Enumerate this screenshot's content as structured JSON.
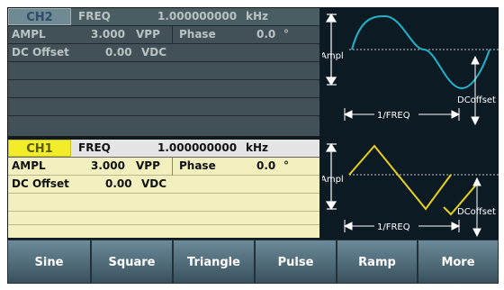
{
  "ch2": {
    "badge": "CH2",
    "freq_label": "FREQ",
    "freq_value": "1.000000000",
    "freq_unit": "kHz",
    "ampl_label": "AMPL",
    "ampl_value": "3.000",
    "ampl_unit": "VPP",
    "phase_label": "Phase",
    "phase_value": "0.0",
    "phase_unit": "°",
    "dc_label": "DC Offset",
    "dc_value": "0.00",
    "dc_unit": "VDC",
    "preview": {
      "ampl": "Ampl",
      "offset": "DCoffset",
      "period": "1/FREQ"
    },
    "colors": {
      "wave": "#1fb3c9",
      "panel": "#415157"
    }
  },
  "ch1": {
    "badge": "CH1",
    "freq_label": "FREQ",
    "freq_value": "1.000000000",
    "freq_unit": "kHz",
    "ampl_label": "AMPL",
    "ampl_value": "3.000",
    "ampl_unit": "VPP",
    "phase_label": "Phase",
    "phase_value": "0.0",
    "phase_unit": "°",
    "dc_label": "DC Offset",
    "dc_value": "0.00",
    "dc_unit": "VDC",
    "preview": {
      "ampl": "Ampl",
      "offset": "DCoffset",
      "period": "1/FREQ"
    },
    "colors": {
      "wave": "#e8d21c",
      "panel": "#f3f0c0"
    }
  },
  "softkeys": [
    "Sine",
    "Square",
    "Triangle",
    "Pulse",
    "Ramp",
    "More"
  ]
}
